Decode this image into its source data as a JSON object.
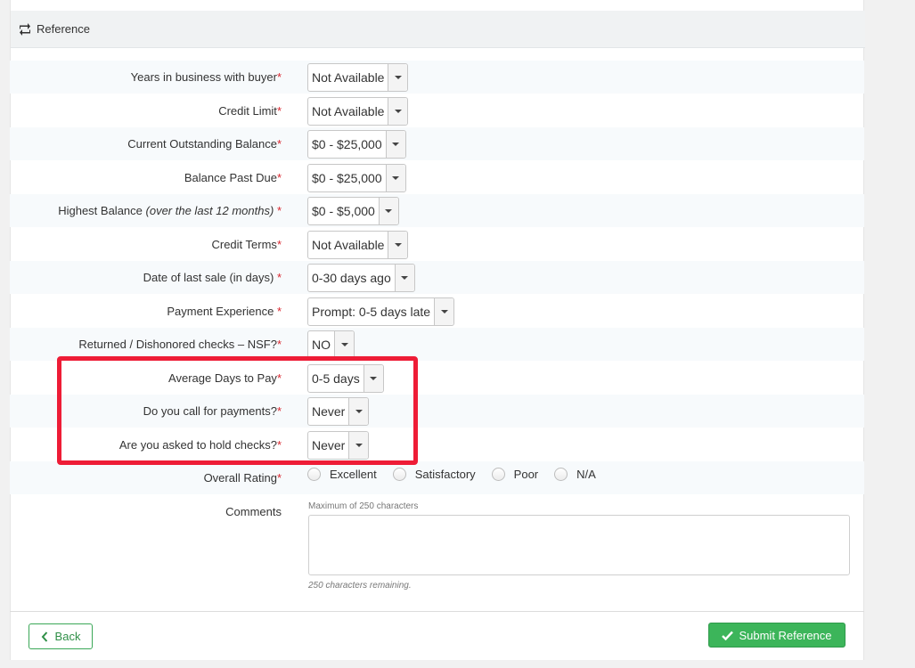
{
  "header": {
    "title": "Reference",
    "icon": "retweet-icon"
  },
  "required_marker": "*",
  "rows": [
    {
      "label": "Years in business with buyer",
      "value": "Not Available"
    },
    {
      "label": "Credit Limit",
      "value": "Not Available"
    },
    {
      "label": "Current Outstanding Balance",
      "value": "$0 - $25,000"
    },
    {
      "label": "Balance Past Due",
      "value": "$0 - $25,000"
    },
    {
      "label": "Highest Balance",
      "label_note": "(over the last 12 months)",
      "value": "$0 - $5,000"
    },
    {
      "label": "Credit Terms",
      "value": "Not Available"
    },
    {
      "label": "Date of last sale (in days)",
      "value": "0-30 days ago"
    },
    {
      "label": "Payment Experience",
      "value": "Prompt: 0-5 days late"
    },
    {
      "label": "Returned / Dishonored checks – NSF?",
      "value": "NO"
    },
    {
      "label": "Average Days to Pay",
      "value": "0-5 days"
    },
    {
      "label": "Do you call for payments?",
      "value": "Never"
    },
    {
      "label": "Are you asked to hold checks?",
      "value": "Never"
    }
  ],
  "rating": {
    "label": "Overall Rating",
    "options": [
      "Excellent",
      "Satisfactory",
      "Poor",
      "N/A"
    ]
  },
  "comments": {
    "label": "Comments",
    "hint": "Maximum of 250 characters",
    "value": "",
    "remaining": "250 characters remaining."
  },
  "buttons": {
    "back": "Back",
    "submit": "Submit Reference"
  },
  "colors": {
    "accent": "#3cb55a",
    "required": "#d9262f",
    "highlight": "#ee1c36"
  }
}
